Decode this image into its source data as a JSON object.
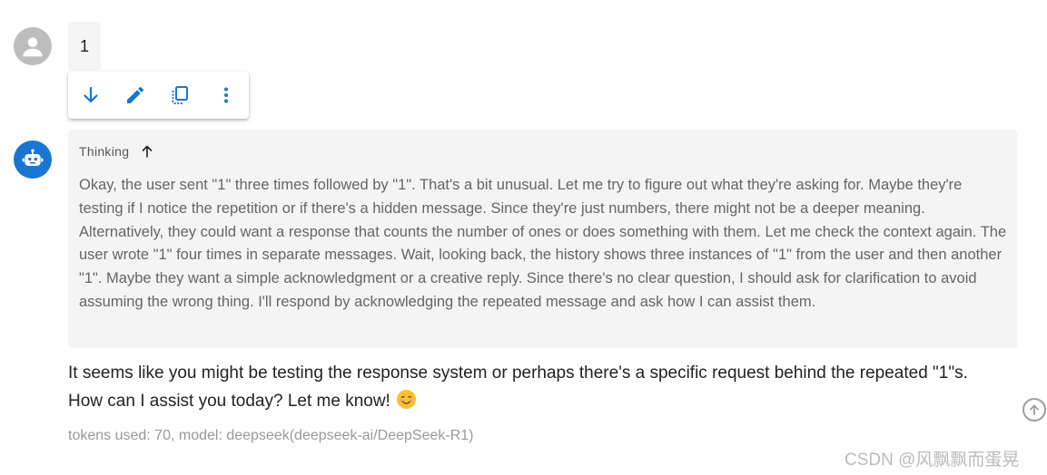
{
  "user_message": {
    "text": "1",
    "actions": [
      {
        "name": "download",
        "icon": "arrow-down-icon"
      },
      {
        "name": "edit",
        "icon": "pencil-icon"
      },
      {
        "name": "copy",
        "icon": "copy-icon"
      },
      {
        "name": "more",
        "icon": "more-vert-icon"
      }
    ]
  },
  "assistant_message": {
    "thinking_label": "Thinking",
    "thinking_text": "Okay, the user sent \"1\" three times followed by \"1\". That's a bit unusual. Let me try to figure out what they're asking for. Maybe they're testing if I notice the repetition or if there's a hidden message. Since they're just numbers, there might not be a deeper meaning. Alternatively, they could want a response that counts the number of ones or does something with them. Let me check the context again. The user wrote \"1\" four times in separate messages. Wait, looking back, the history shows three instances of \"1\" from the user and then another \"1\". Maybe they want a simple acknowledgment or a creative reply. Since there's no clear question, I should ask for clarification to avoid assuming the wrong thing. I'll respond by acknowledging the repeated message and ask how I can assist them.",
    "answer_text": "It seems like you might be testing the response system or perhaps there's a specific request behind the repeated \"1\"s. How can I assist you today? Let me know!",
    "meta": "tokens used: 70, model: deepseek(deepseek-ai/DeepSeek-R1)"
  },
  "watermark": "CSDN @风飘飘而蛋晃",
  "colors": {
    "accent": "#1976d2",
    "user_avatar": "#bdbdbd",
    "thinking_bg": "#f4f4f4",
    "bubble_bg": "#f5f5f5"
  }
}
